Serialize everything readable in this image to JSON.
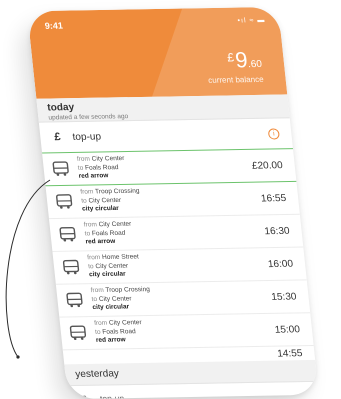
{
  "status_bar": {
    "time": "9:41",
    "icons": "•ıl ≈ ▬"
  },
  "header": {
    "currency": "£",
    "amount_major": "9",
    "amount_minor": ".60",
    "balance_label": "current balance"
  },
  "today": {
    "title": "today",
    "subtitle": "updated a few seconds ago"
  },
  "topup_row": {
    "symbol": "£",
    "label": "top-up"
  },
  "journeys": [
    {
      "from_label": "from",
      "from": "City Center",
      "to_label": "to",
      "to": "Foals Road",
      "route": "red arrow",
      "value": "£20.00"
    },
    {
      "from_label": "from",
      "from": "Troop Crossing",
      "to_label": "to",
      "to": "City Center",
      "route": "city circular",
      "value": "16:55"
    },
    {
      "from_label": "from",
      "from": "City Center",
      "to_label": "to",
      "to": "Foals Road",
      "route": "red arrow",
      "value": "16:30"
    },
    {
      "from_label": "from",
      "from": "Home Street",
      "to_label": "to",
      "to": "City Center",
      "route": "city circular",
      "value": "16:00"
    },
    {
      "from_label": "from",
      "from": "Troop Crossing",
      "to_label": "to",
      "to": "City Center",
      "route": "city circular",
      "value": "15:30"
    },
    {
      "from_label": "from",
      "from": "City Center",
      "to_label": "to",
      "to": "Foals Road",
      "route": "red arrow",
      "value": "15:00"
    }
  ],
  "trailing_value": "14:55",
  "yesterday": {
    "title": "yesterday"
  },
  "topup_row_2": {
    "symbol": "£",
    "label": "top-up"
  },
  "colors": {
    "accent": "#ef8b3b",
    "highlight": "#6cc36c"
  },
  "icons": {
    "journey": "bus-icon",
    "topup_info": "info-icon"
  }
}
